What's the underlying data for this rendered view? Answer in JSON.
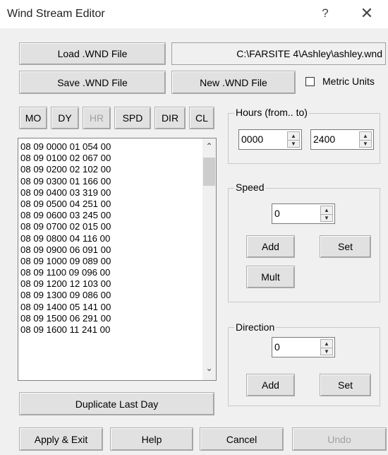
{
  "window": {
    "title": "Wind Stream Editor",
    "help_glyph": "?",
    "close_glyph": "✕"
  },
  "file": {
    "load_label": "Load .WND File",
    "path": "C:\\FARSITE 4\\Ashley\\ashley.wnd",
    "save_label": "Save .WND File",
    "new_label": "New .WND File",
    "metric_label": "Metric Units",
    "metric_checked": false
  },
  "columns": [
    {
      "label": "MO",
      "enabled": true
    },
    {
      "label": "DY",
      "enabled": true
    },
    {
      "label": "HR",
      "enabled": false
    },
    {
      "label": "SPD",
      "enabled": true
    },
    {
      "label": "DIR",
      "enabled": true
    },
    {
      "label": "CL",
      "enabled": true
    }
  ],
  "rows": [
    "08 09 0000 01 054 00",
    "08 09 0100 02 067 00",
    "08 09 0200 02 102 00",
    "08 09 0300 01 166 00",
    "08 09 0400 03 319 00",
    "08 09 0500 04 251 00",
    "08 09 0600 03 245 00",
    "08 09 0700 02 015 00",
    "08 09 0800 04 116 00",
    "08 09 0900 06 091 00",
    "08 09 1000 09 089 00",
    "08 09 1100 09 096 00",
    "08 09 1200 12 103 00",
    "08 09 1300 09 086 00",
    "08 09 1400 05 141 00",
    "08 09 1500 06 291 00",
    "08 09 1600 11 241 00"
  ],
  "scroll": {
    "up_glyph": "⌃",
    "down_glyph": "⌄"
  },
  "hours": {
    "label": "Hours (from.. to)",
    "from": "0000",
    "to": "2400"
  },
  "speed": {
    "label": "Speed",
    "value": "0",
    "add_label": "Add",
    "set_label": "Set",
    "mult_label": "Mult"
  },
  "direction": {
    "label": "Direction",
    "value": "0",
    "add_label": "Add",
    "set_label": "Set"
  },
  "duplicate_label": "Duplicate Last Day",
  "footer": {
    "apply_label": "Apply & Exit",
    "help_label": "Help",
    "cancel_label": "Cancel",
    "undo_label": "Undo"
  },
  "spin_glyphs": {
    "up": "▲",
    "down": "▼"
  }
}
